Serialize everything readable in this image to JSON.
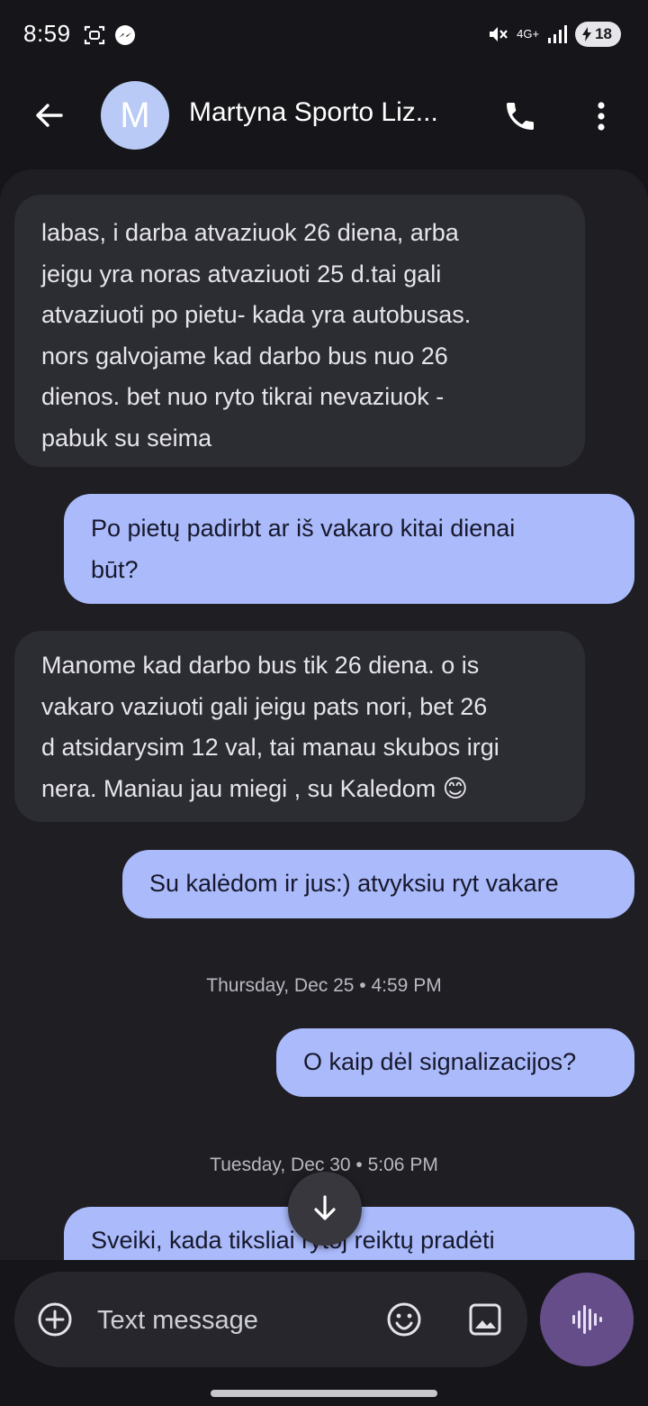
{
  "status_bar": {
    "time": "8:59",
    "network": "4G+",
    "battery": "18"
  },
  "header": {
    "avatar_letter": "M",
    "contact_name": "Martyna Sporto Liz..."
  },
  "messages": [
    {
      "direction": "incoming",
      "lines": [
        "labas, i darba atvaziuok 26 diena, arba",
        "jeigu yra noras atvaziuoti  25 d.tai gali",
        "atvaziuoti po pietu- kada yra autobusas.",
        "nors galvojame kad darbo bus nuo 26",
        "dienos. bet nuo ryto tikrai nevaziuok -",
        "pabuk su seima"
      ]
    },
    {
      "direction": "outgoing",
      "lines": [
        "Po pietų padirbt ar iš vakaro kitai dienai",
        "būt?"
      ]
    },
    {
      "direction": "incoming",
      "lines": [
        "Manome kad darbo bus tik 26 diena. o is",
        "vakaro vaziuoti gali jeigu pats nori, bet 26",
        "d atsidarysim 12 val, tai manau skubos irgi",
        "nera. Maniau jau miegi , su Kaledom 😊"
      ]
    },
    {
      "direction": "outgoing",
      "lines": [
        "Su kalėdom ir jus:) atvyksiu ryt vakare"
      ]
    },
    {
      "direction": "outgoing",
      "lines": [
        "O kaip dėl signalizacijos?"
      ]
    },
    {
      "direction": "outgoing",
      "lines": [
        "Sveiki, kada tiksliai rytoj reiktų pradėti"
      ]
    }
  ],
  "timestamps": [
    "Thursday, Dec 25 • 4:59 PM",
    "Tuesday, Dec 30 • 5:06 PM"
  ],
  "composer": {
    "placeholder": "Text message"
  },
  "icons": {
    "back": "arrow-back-icon",
    "call": "phone-icon",
    "more": "more-vert-icon",
    "scroll": "arrow-down-icon",
    "add": "add-circle-icon",
    "emoji": "emoji-icon",
    "gallery": "gallery-icon",
    "voice": "voice-waveform-icon"
  },
  "colors": {
    "incoming_bubble": "#2c2c33",
    "outgoing_bubble": "#aabafb",
    "avatar": "#b8caf5",
    "voice_button": "#654d8a"
  }
}
